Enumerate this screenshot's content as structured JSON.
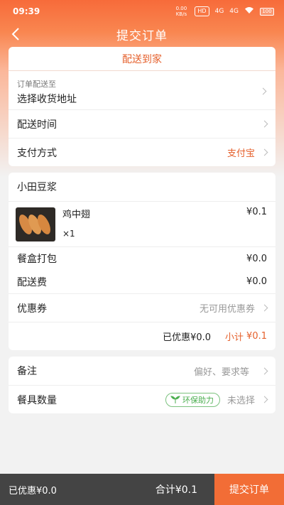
{
  "status": {
    "time": "09:39",
    "speed": "0.00 KB/s",
    "hd": "HD",
    "net1": "4G",
    "net2": "4G",
    "battery": "100"
  },
  "nav": {
    "title": "提交订单"
  },
  "delivery_card": {
    "mode_label": "配送到家",
    "address_caption": "订单配送至",
    "address_value": "选择收货地址",
    "time_label": "配送时间",
    "payment_label": "支付方式",
    "payment_value": "支付宝"
  },
  "shop_card": {
    "shop_name": "小田豆浆",
    "item": {
      "name": "鸡中翅",
      "price": "¥0.1",
      "qty": "×1"
    },
    "packing_label": "餐盒打包",
    "packing_value": "¥0.0",
    "delivery_fee_label": "配送费",
    "delivery_fee_value": "¥0.0",
    "coupon_label": "优惠券",
    "coupon_value": "无可用优惠券",
    "discount_text": "已优惠¥0.0",
    "subtotal_label": "小计",
    "subtotal_value": "¥0.1"
  },
  "notes_card": {
    "remark_label": "备注",
    "remark_placeholder": "偏好、要求等",
    "utensils_label": "餐具数量",
    "eco_badge": "环保助力",
    "utensils_value": "未选择"
  },
  "bottom": {
    "discount_text": "已优惠¥0.0",
    "total_text": "合计¥0.1",
    "submit_label": "提交订单"
  },
  "colors": {
    "accent": "#f26d36",
    "bottom_bar": "#444444",
    "eco_green": "#4caf50"
  }
}
